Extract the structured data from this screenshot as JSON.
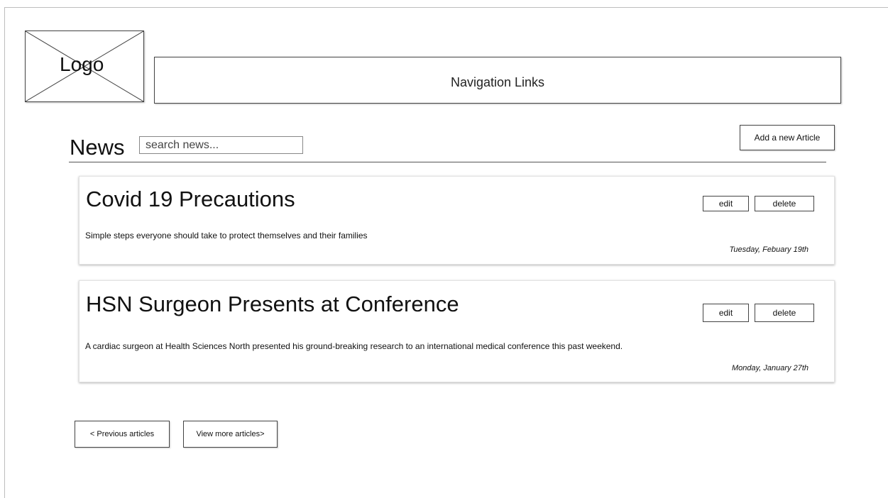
{
  "header": {
    "logo_label": "Logo",
    "nav_label": "Navigation Links"
  },
  "news": {
    "title": "News",
    "search_placeholder": "search news...",
    "add_button_label": "Add a new Article"
  },
  "articles": [
    {
      "title": "Covid 19 Precautions",
      "summary": "Simple steps everyone should take to protect themselves and their families",
      "date": "Tuesday, Febuary 19th",
      "edit_label": "edit",
      "delete_label": "delete"
    },
    {
      "title": "HSN Surgeon Presents at Conference",
      "summary": "A cardiac surgeon at Health Sciences North presented his ground-breaking research to an international medical conference this past weekend.",
      "date": "Monday, January 27th",
      "edit_label": "edit",
      "delete_label": "delete"
    }
  ],
  "pagination": {
    "prev_label": "< Previous articles",
    "next_label": "View more articles>"
  }
}
